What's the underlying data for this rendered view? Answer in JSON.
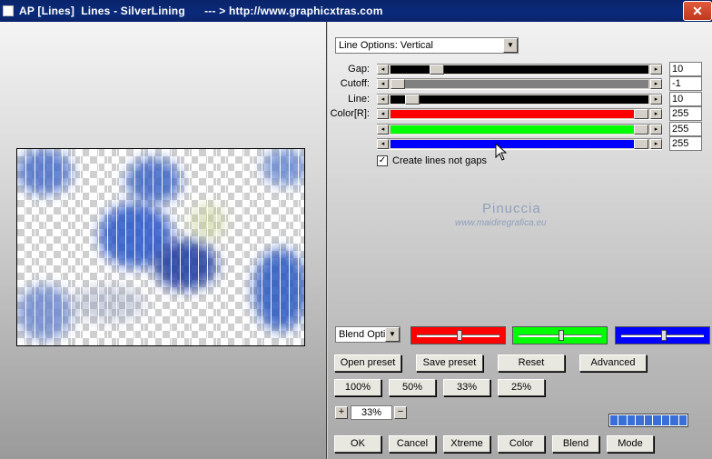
{
  "window": {
    "title": "AP [Lines]  Lines - SilverLining      --- > http://www.graphicxtras.com",
    "close_label": "✕"
  },
  "options": {
    "selected": "Line Options: Vertical"
  },
  "sliders": [
    {
      "label": "Gap:",
      "value": "10",
      "level": 0.16,
      "track_color": "#000000"
    },
    {
      "label": "Cutoff:",
      "value": "-1",
      "level": 0.0,
      "track_color": "#808080"
    },
    {
      "label": "Line:",
      "value": "10",
      "level": 0.06,
      "track_color": "#000000"
    },
    {
      "label": "Color[R]:",
      "value": "255",
      "level": 1.0,
      "track_color": "#ff0000"
    },
    {
      "label": "",
      "value": "255",
      "level": 1.0,
      "track_color": "#00ff00"
    },
    {
      "label": "",
      "value": "255",
      "level": 1.0,
      "track_color": "#0000ff"
    }
  ],
  "checkbox": {
    "label": "Create lines not gaps",
    "checked": true,
    "mark": "✓"
  },
  "watermark": {
    "name": "Pinuccia",
    "url": "www.maidiregrafica.eu"
  },
  "blend": {
    "selected": "Blend Optio",
    "colorbars": [
      {
        "color": "#ff0000",
        "level": 0.5
      },
      {
        "color": "#00ff00",
        "level": 0.5
      },
      {
        "color": "#0000ff",
        "level": 0.5
      }
    ]
  },
  "preset_buttons": {
    "open": "Open preset",
    "save": "Save preset",
    "reset": "Reset",
    "advanced": "Advanced"
  },
  "zoom_buttons": [
    "100%",
    "50%",
    "33%",
    "25%"
  ],
  "zoom": {
    "plus": "+",
    "minus": "−",
    "value": "33%"
  },
  "progress": {
    "segments": 9
  },
  "bottom_buttons": {
    "ok": "OK",
    "cancel": "Cancel",
    "xtreme": "Xtreme",
    "color": "Color",
    "blend": "Blend",
    "mode": "Mode"
  }
}
